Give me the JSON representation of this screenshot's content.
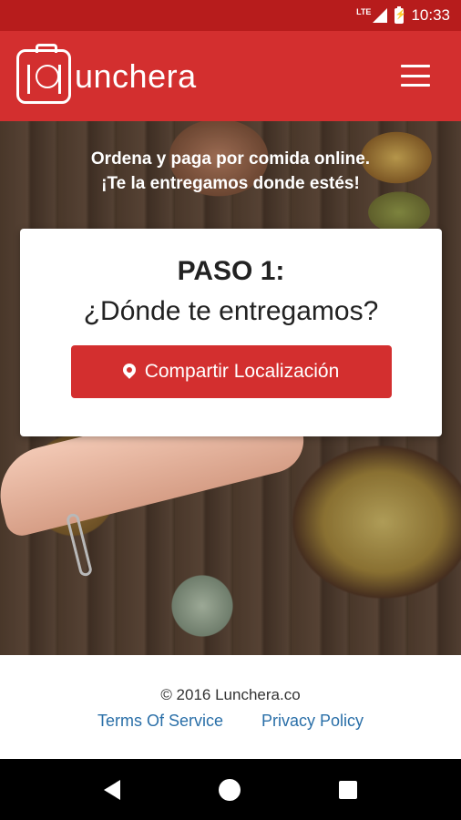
{
  "status_bar": {
    "network": "LTE",
    "time": "10:33"
  },
  "app_bar": {
    "brand_text": "unchera",
    "menu_icon": "hamburger-menu-icon"
  },
  "hero": {
    "tagline_line1": "Ordena y paga por comida online.",
    "tagline_line2": "¡Te la entregamos donde estés!"
  },
  "card": {
    "step_title": "PASO 1:",
    "question": "¿Dónde te entregamos?",
    "share_button_label": "Compartir Localización",
    "share_button_icon": "location-pin-icon"
  },
  "footer": {
    "copyright": "© 2016 Lunchera.co",
    "terms_link": "Terms Of Service",
    "privacy_link": "Privacy Policy"
  },
  "colors": {
    "primary": "#d32f2f",
    "status_bar": "#b71c1c",
    "link": "#2a6fa8"
  }
}
